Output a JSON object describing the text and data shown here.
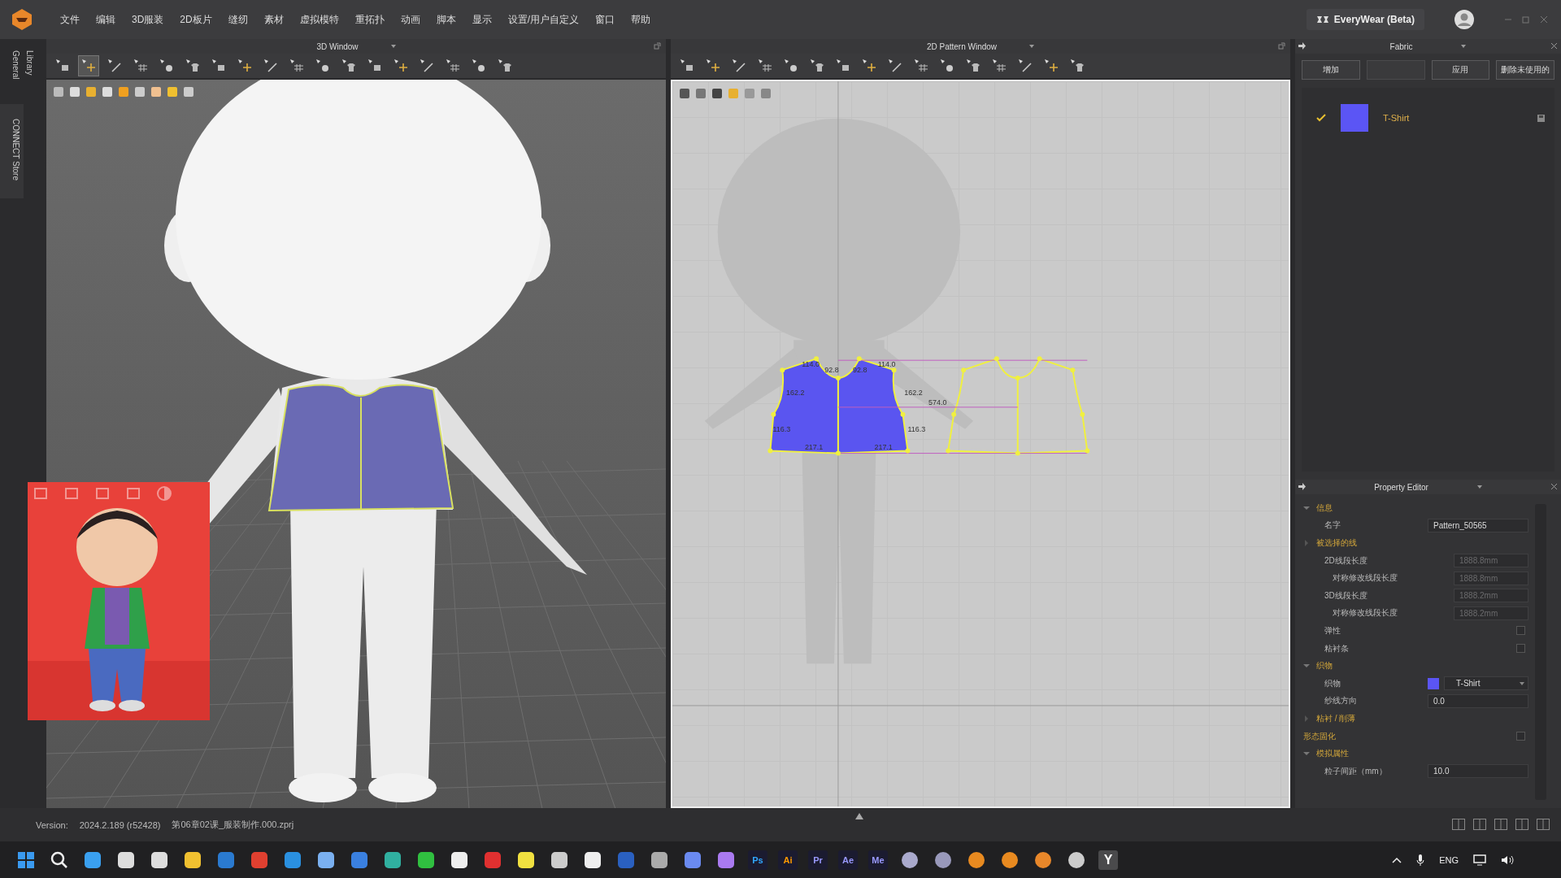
{
  "menubar": {
    "items": [
      "文件",
      "编辑",
      "3D服装",
      "2D板片",
      "缝纫",
      "素材",
      "虚拟模特",
      "重拓扑",
      "动画",
      "脚本",
      "显示",
      "设置/用户自定义",
      "窗口",
      "帮助"
    ],
    "account": "EveryWear (Beta)"
  },
  "side_tabs": [
    "General",
    "Library",
    "CONNECT Store"
  ],
  "window_3d": {
    "title": "3D Window",
    "tools": [
      {
        "selected": false
      },
      {
        "selected": true
      },
      {
        "selected": false
      },
      {
        "selected": false
      },
      {
        "selected": false
      },
      {
        "selected": false
      },
      {
        "selected": false
      },
      {
        "selected": false
      },
      {
        "selected": false
      },
      {
        "selected": false
      },
      {
        "selected": false
      },
      {
        "selected": false
      },
      {
        "selected": false
      },
      {
        "selected": false
      },
      {
        "selected": false
      },
      {
        "selected": false
      },
      {
        "selected": false
      },
      {
        "selected": false
      }
    ]
  },
  "window_2d": {
    "title": "2D Pattern Window",
    "measurements": [
      "114.0",
      "92.8",
      "92.8",
      "114.0",
      "162.2",
      "162.2",
      "574.0",
      "116.3",
      "116.3",
      "217.1",
      "217.1"
    ]
  },
  "fabric_panel": {
    "title": "Fabric",
    "buttons": [
      {
        "label": "增加",
        "disabled": false
      },
      {
        "disabled": true
      },
      {
        "label": "应用",
        "disabled": false
      },
      {
        "label": "删除未使用的",
        "disabled": false
      }
    ],
    "fabrics": [
      {
        "name": "T-Shirt",
        "color": "#5b55f5",
        "checked": true,
        "selected": true
      }
    ]
  },
  "property_editor": {
    "title": "Property Editor",
    "rows": [
      {
        "kind": "section",
        "label": "信息",
        "expanded": true,
        "children": [
          {
            "kind": "field",
            "label": "名字",
            "value": "Pattern_50565",
            "disabled": false
          }
        ]
      },
      {
        "kind": "section",
        "label": "被选择的线",
        "expanded": false,
        "children": [
          {
            "kind": "field",
            "label": "2D线段长度",
            "value": "1888.8mm",
            "disabled": true,
            "children": [
              {
                "kind": "field",
                "label": "对称修改线段长度",
                "value": "1888.8mm",
                "disabled": true
              }
            ]
          },
          {
            "kind": "field",
            "label": "3D线段长度",
            "value": "1888.2mm",
            "disabled": true,
            "children": [
              {
                "kind": "field",
                "label": "对称修改线段长度",
                "value": "1888.2mm",
                "disabled": true
              }
            ]
          },
          {
            "kind": "checkbox",
            "label": "弹性",
            "checked": false
          },
          {
            "kind": "checkbox",
            "label": "粘衬条",
            "checked": false
          }
        ]
      },
      {
        "kind": "section",
        "label": "织物",
        "expanded": true,
        "children": [
          {
            "kind": "fabric",
            "label": "织物",
            "value": "T-Shirt",
            "color": "#5b55f5"
          },
          {
            "kind": "field",
            "label": "纱线方向",
            "value": "0.0",
            "disabled": false
          }
        ]
      },
      {
        "kind": "section",
        "label": "粘衬 / 削薄",
        "expanded": false
      },
      {
        "kind": "toggle",
        "label": "形态固化",
        "checked": false
      },
      {
        "kind": "section",
        "label": "模拟属性",
        "expanded": true,
        "children": [
          {
            "kind": "field",
            "label": "粒子间距（mm）",
            "value": "10.0",
            "disabled": false
          }
        ]
      }
    ]
  },
  "status_bar": {
    "version_label": "Version:",
    "version": "2024.2.189 (r52428)",
    "file": "第06章02课_服装制作.000.zprj"
  },
  "taskbar": {
    "apps_a": [
      {
        "label": "Ps",
        "color": "#31a8ff"
      },
      {
        "label": "Ai",
        "color": "#ff9a00"
      },
      {
        "label": "Pr",
        "color": "#9999ff"
      },
      {
        "label": "Ae",
        "color": "#9999ff"
      },
      {
        "label": "Me",
        "color": "#9999ff"
      }
    ],
    "apps_b": [
      {
        "label": "Y"
      }
    ],
    "language": "ENG"
  }
}
